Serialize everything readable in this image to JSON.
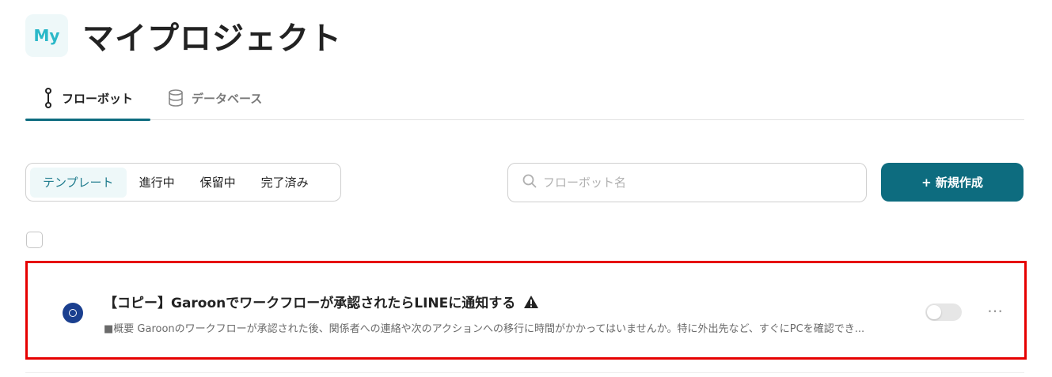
{
  "header": {
    "avatar_text": "My",
    "title": "マイプロジェクト"
  },
  "tabs": [
    {
      "label": "フローボット",
      "icon": "flowbot-icon",
      "active": true
    },
    {
      "label": "データベース",
      "icon": "database-icon",
      "active": false
    }
  ],
  "filters": [
    {
      "label": "テンプレート",
      "active": true
    },
    {
      "label": "進行中",
      "active": false
    },
    {
      "label": "保留中",
      "active": false
    },
    {
      "label": "完了済み",
      "active": false
    }
  ],
  "search": {
    "placeholder": "フローボット名",
    "icon": "search-icon"
  },
  "new_button": {
    "label": "+ 新規作成"
  },
  "flowbot": {
    "logo_text": "Garoon",
    "title": "【コピー】Garoonでワークフローが承認されたらLINEに通知する",
    "warning_icon": "warning-icon",
    "description": "■概要 Garoonのワークフローが承認された後、関係者への連絡や次のアクションへの移行に時間がかかってはいませんか。特に外出先など、すぐにPCを確認でき...",
    "enabled": false
  },
  "colors": {
    "accent": "#0d6c7f",
    "highlight_border": "#e60000",
    "active_filter_bg": "#eef8f9"
  }
}
